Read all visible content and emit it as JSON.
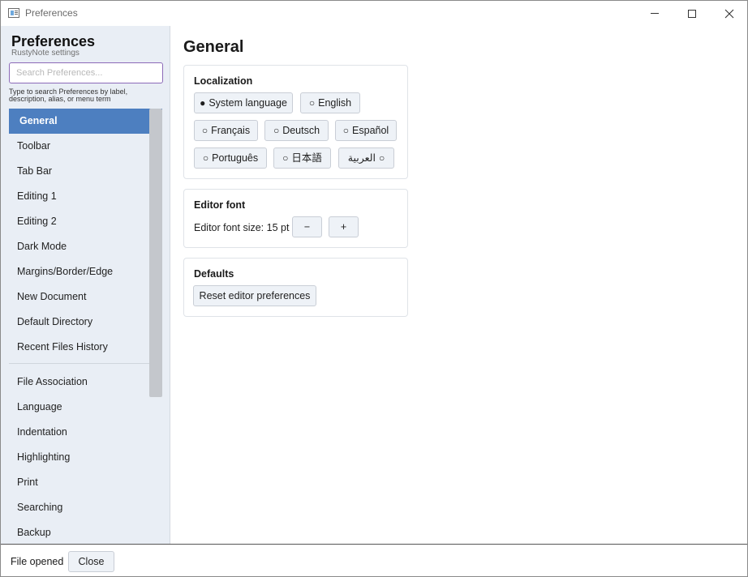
{
  "window": {
    "title": "Preferences"
  },
  "sidebar": {
    "title": "Preferences",
    "subtitle": "RustyNote settings",
    "search_placeholder": "Search Preferences...",
    "search_hint": "Type to search Preferences by label, description, alias, or menu term",
    "items_group1": [
      "General",
      "Toolbar",
      "Tab Bar",
      "Editing 1",
      "Editing 2",
      "Dark Mode",
      "Margins/Border/Edge",
      "New Document",
      "Default Directory",
      "Recent Files History"
    ],
    "items_group2": [
      "File Association",
      "Language",
      "Indentation",
      "Highlighting",
      "Print",
      "Searching",
      "Backup"
    ],
    "active_item": "General"
  },
  "main": {
    "title": "General",
    "localization": {
      "title": "Localization",
      "options": [
        {
          "label": "System language",
          "selected": true,
          "mark": "●"
        },
        {
          "label": "English",
          "selected": false,
          "mark": "○"
        },
        {
          "label": "Français",
          "selected": false,
          "mark": "○"
        },
        {
          "label": "Deutsch",
          "selected": false,
          "mark": "○"
        },
        {
          "label": "Español",
          "selected": false,
          "mark": "○"
        },
        {
          "label": "Português",
          "selected": false,
          "mark": "○"
        },
        {
          "label": "日本語",
          "selected": false,
          "mark": "○"
        },
        {
          "label": "العربية",
          "selected": false,
          "mark": "○"
        }
      ]
    },
    "editor_font": {
      "title": "Editor font",
      "size_label": "Editor font size: 15 pt",
      "decrease_label": "−",
      "increase_label": "+"
    },
    "defaults": {
      "title": "Defaults",
      "reset_label": "Reset editor preferences"
    }
  },
  "statusbar": {
    "text": "File opened",
    "close_label": "Close"
  }
}
